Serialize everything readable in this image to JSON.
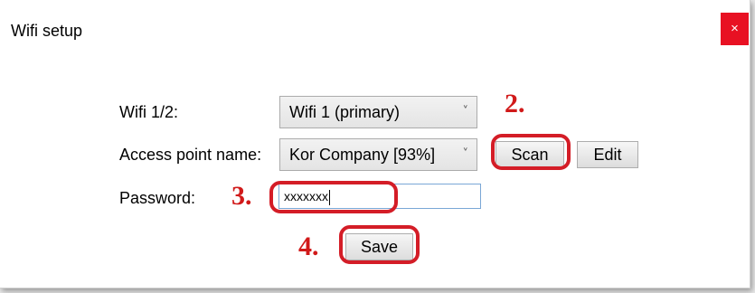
{
  "window": {
    "title": "Wifi setup",
    "close_glyph": "×"
  },
  "form": {
    "wifi_label": "Wifi 1/2:",
    "wifi_selected": "Wifi 1 (primary)",
    "ap_label": "Access point name:",
    "ap_selected": "Kor Company [93%]",
    "password_label": "Password:",
    "password_value": "xxxxxxx",
    "chevron_glyph": "˅"
  },
  "buttons": {
    "scan": "Scan",
    "edit": "Edit",
    "save": "Save"
  },
  "annotations": {
    "step2": "2.",
    "step3": "3.",
    "step4": "4.",
    "color": "#d11a1a"
  }
}
